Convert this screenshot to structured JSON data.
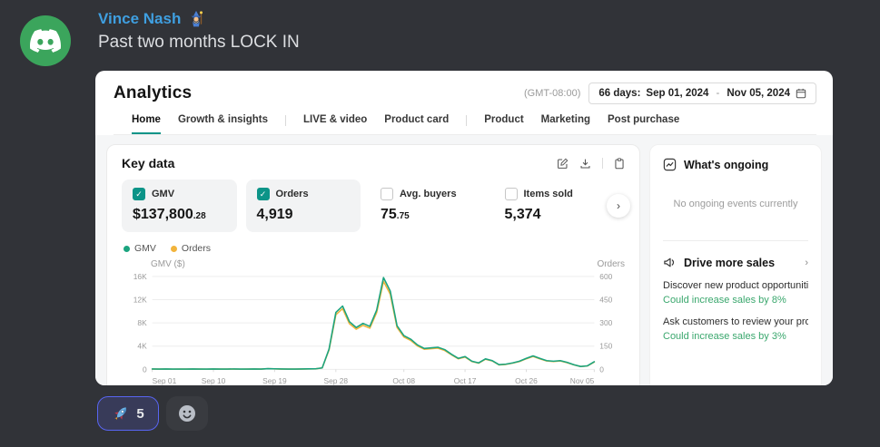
{
  "colors": {
    "accent_teal": "#0c9488",
    "gmv_line": "#1ba47f",
    "orders_line": "#f2b43c",
    "positive_green": "#3aa76d",
    "reaction_border": "#5865f2"
  },
  "message": {
    "username": "Vince Nash",
    "text": "Past two months LOCK IN",
    "reaction": {
      "emoji_name": "rocket",
      "count": "5"
    }
  },
  "dashboard": {
    "title": "Analytics",
    "timezone": "(GMT-08:00)",
    "date_range": {
      "days": "66 days:",
      "start": "Sep 01, 2024",
      "separator": "-",
      "end": "Nov 05, 2024"
    },
    "tabs": [
      {
        "label": "Home",
        "active": true
      },
      {
        "label": "Growth & insights",
        "active": false
      },
      {
        "label": "LIVE & video",
        "active": false
      },
      {
        "label": "Product card",
        "active": false
      },
      {
        "label": "Product",
        "active": false
      },
      {
        "label": "Marketing",
        "active": false
      },
      {
        "label": "Post purchase",
        "active": false
      }
    ],
    "key_data": {
      "title": "Key data",
      "metrics": [
        {
          "label": "GMV",
          "value": "$137,800",
          "decimal": ".28",
          "checked": true
        },
        {
          "label": "Orders",
          "value": "4,919",
          "decimal": "",
          "checked": true
        },
        {
          "label": "Avg. buyers",
          "value": "75",
          "decimal": ".75",
          "checked": false
        },
        {
          "label": "Items sold",
          "value": "5,374",
          "decimal": "",
          "checked": false
        }
      ],
      "legend": [
        {
          "label": "GMV",
          "color": "#1ba47f"
        },
        {
          "label": "Orders",
          "color": "#f2b43c"
        }
      ]
    },
    "ongoing": {
      "title": "What's ongoing",
      "empty": "No ongoing events currently"
    },
    "drive_sales": {
      "title": "Drive more sales",
      "items": [
        {
          "title": "Discover new product opportuniti...",
          "subtitle": "Could increase sales by 8%"
        },
        {
          "title": "Ask customers to review your pro...",
          "subtitle": "Could increase sales by 3%"
        }
      ]
    }
  },
  "chart_data": {
    "type": "line",
    "title": "Key data — GMV and Orders, Sep 01 2024 to Nov 05 2024",
    "x_tick_labels": [
      "Sep 01",
      "Sep 10",
      "Sep 19",
      "Sep 28",
      "Oct 08",
      "Oct 17",
      "Oct 26",
      "Nov 05"
    ],
    "x_tick_positions": [
      0,
      9,
      18,
      27,
      37,
      46,
      55,
      65
    ],
    "x_max": 65,
    "grid": true,
    "legend_position": "top-left",
    "left_axis": {
      "label": "GMV ($)",
      "ticks": [
        "16K",
        "12K",
        "8K",
        "4K",
        "0"
      ],
      "max": 16000,
      "min": 0
    },
    "right_axis": {
      "label": "Orders",
      "ticks": [
        "600",
        "450",
        "300",
        "150",
        "0"
      ],
      "max": 600,
      "min": 0
    },
    "series": [
      {
        "name": "GMV",
        "axis": "left",
        "color": "#1ba47f",
        "values": [
          60,
          45,
          55,
          40,
          50,
          45,
          60,
          50,
          40,
          55,
          45,
          50,
          60,
          40,
          50,
          55,
          45,
          120,
          90,
          60,
          50,
          45,
          55,
          70,
          90,
          250,
          3500,
          9800,
          10900,
          8200,
          7200,
          7900,
          7400,
          10200,
          15800,
          13500,
          7500,
          5800,
          5200,
          4200,
          3600,
          3700,
          3800,
          3400,
          2600,
          1900,
          2200,
          1400,
          1100,
          1800,
          1500,
          800,
          900,
          1100,
          1400,
          1900,
          2300,
          1900,
          1500,
          1400,
          1500,
          1200,
          800,
          500,
          600,
          1300
        ]
      },
      {
        "name": "Orders",
        "axis": "right",
        "color": "#f2b43c",
        "values": [
          2,
          2,
          2,
          1,
          2,
          2,
          2,
          2,
          1,
          2,
          2,
          2,
          2,
          1,
          2,
          2,
          2,
          4,
          3,
          2,
          2,
          2,
          2,
          3,
          3,
          9,
          126,
          353,
          392,
          295,
          259,
          284,
          266,
          367,
          569,
          486,
          270,
          209,
          187,
          151,
          130,
          133,
          137,
          122,
          94,
          68,
          79,
          50,
          40,
          65,
          54,
          29,
          32,
          40,
          50,
          68,
          83,
          68,
          54,
          50,
          54,
          43,
          29,
          18,
          22,
          47
        ]
      }
    ]
  }
}
